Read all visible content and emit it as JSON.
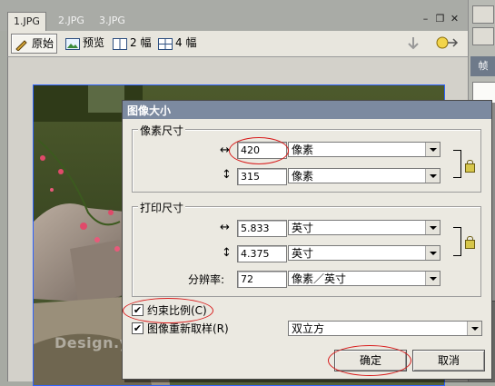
{
  "tabs": [
    "1.JPG",
    "2.JPG",
    "3.JPG"
  ],
  "view_buttons": [
    {
      "label": "原始",
      "icon": "pencil-icon"
    },
    {
      "label": "预览",
      "icon": "preview-icon"
    },
    {
      "label": "2 幅",
      "icon": "two-up-icon"
    },
    {
      "label": "4 幅",
      "icon": "four-up-icon"
    }
  ],
  "right_panel": {
    "tab_label": "帧"
  },
  "dialog": {
    "title": "图像大小",
    "pixel_dimensions": {
      "group_label": "像素尺寸",
      "width_value": "420",
      "width_unit": "像素",
      "height_value": "315",
      "height_unit": "像素"
    },
    "print_size": {
      "group_label": "打印尺寸",
      "width_value": "5.833",
      "width_unit": "英寸",
      "height_value": "4.375",
      "height_unit": "英寸",
      "resolution_label": "分辨率:",
      "resolution_value": "72",
      "resolution_unit": "像素／英寸"
    },
    "constrain_label": "约束比例(C)",
    "constrain_checked": true,
    "resample_label": "图像重新取样(R)",
    "resample_checked": true,
    "resample_method": "双立方",
    "ok_label": "确定",
    "cancel_label": "取消"
  },
  "watermark": "Design.yesky.com",
  "colors": {
    "highlight_ring": "#d81c1c",
    "title_bar": "#7c8aa0",
    "selection_border": "#2e63ff"
  }
}
